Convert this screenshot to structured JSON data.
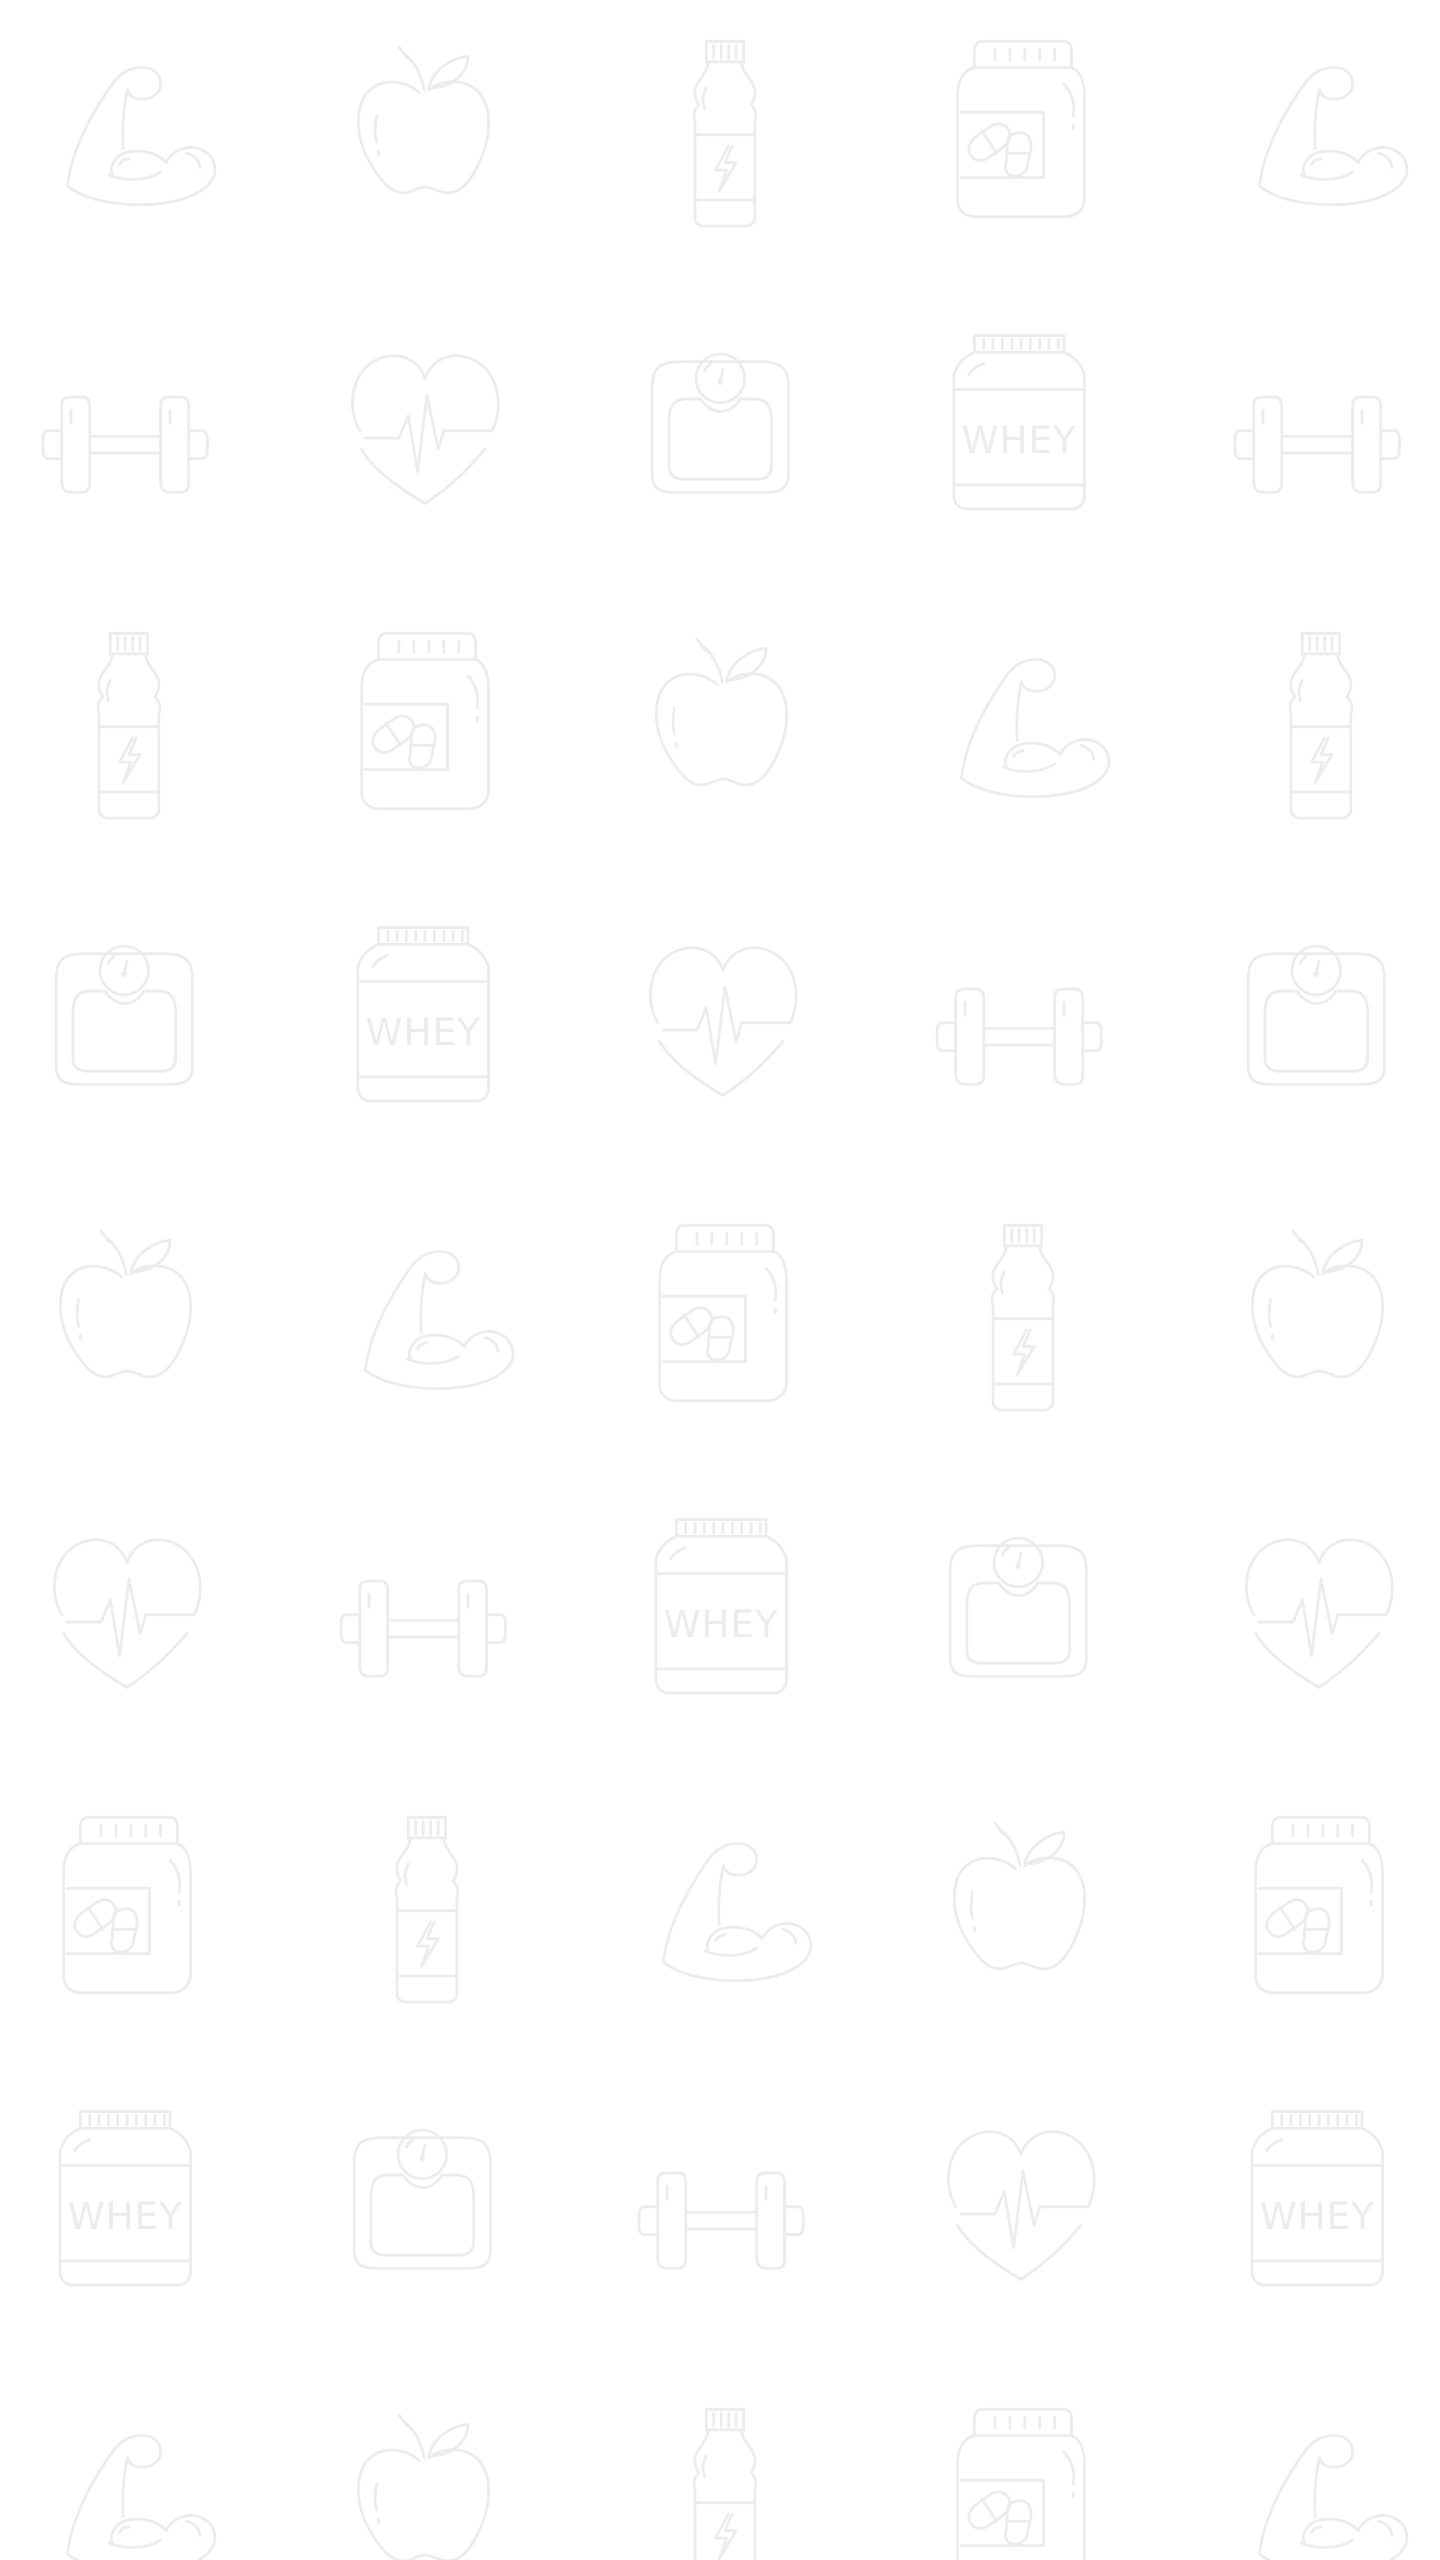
{
  "background_color": "#ffffff",
  "icon_stroke_color": "#ececec",
  "icon_text_color": "#ececec",
  "whey_label": "WHEY",
  "rows": [
    [
      "flexed-bicep-icon",
      "apple-icon",
      "energy-drink-bottle-icon",
      "pill-jar-icon",
      "flexed-bicep-icon"
    ],
    [
      "dumbbell-icon",
      "heartbeat-icon",
      "bathroom-scale-icon",
      "whey-protein-jar-icon",
      "dumbbell-icon"
    ],
    [
      "energy-drink-bottle-icon",
      "pill-jar-icon",
      "apple-icon",
      "flexed-bicep-icon",
      "energy-drink-bottle-icon"
    ],
    [
      "bathroom-scale-icon",
      "whey-protein-jar-icon",
      "heartbeat-icon",
      "dumbbell-icon",
      "bathroom-scale-icon"
    ],
    [
      "apple-icon",
      "flexed-bicep-icon",
      "pill-jar-icon",
      "energy-drink-bottle-icon",
      "apple-icon"
    ],
    [
      "heartbeat-icon",
      "dumbbell-icon",
      "whey-protein-jar-icon",
      "bathroom-scale-icon",
      "heartbeat-icon"
    ],
    [
      "pill-jar-icon",
      "energy-drink-bottle-icon",
      "flexed-bicep-icon",
      "apple-icon",
      "pill-jar-icon"
    ],
    [
      "whey-protein-jar-icon",
      "bathroom-scale-icon",
      "dumbbell-icon",
      "heartbeat-icon",
      "whey-protein-jar-icon"
    ],
    [
      "flexed-bicep-icon",
      "apple-icon",
      "energy-drink-bottle-icon",
      "pill-jar-icon",
      "flexed-bicep-icon"
    ]
  ]
}
